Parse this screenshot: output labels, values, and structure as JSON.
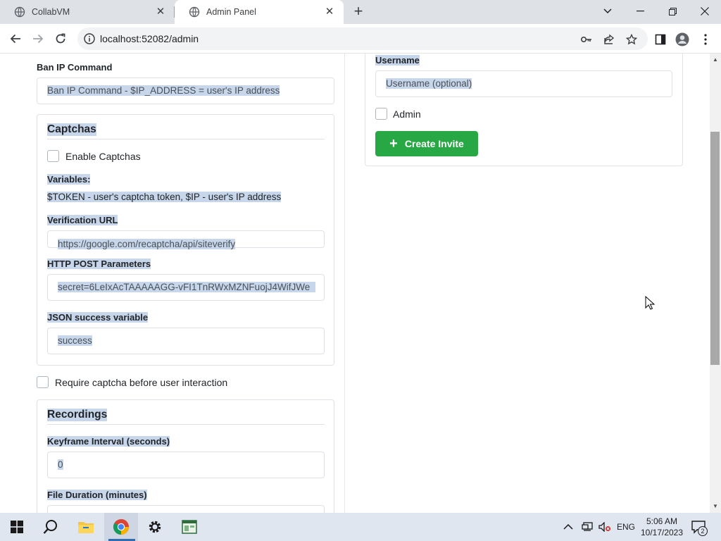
{
  "browser": {
    "tabs": [
      {
        "title": "CollabVM",
        "active": false
      },
      {
        "title": "Admin Panel",
        "active": true
      }
    ],
    "url": "localhost:52082/admin"
  },
  "left_column": {
    "ban_ip": {
      "label": "Ban IP Command",
      "value": "Ban IP Command - $IP_ADDRESS = user's IP address"
    },
    "captchas": {
      "title": "Captchas",
      "enable_label": "Enable Captchas",
      "enable_checked": false,
      "variables_label": "Variables:",
      "variables_text": "$TOKEN - user's captcha token, $IP - user's IP address",
      "verification_url_label": "Verification URL",
      "verification_url_value": "https://google.com/recaptcha/api/siteverify",
      "post_params_label": "HTTP POST Parameters",
      "post_params_value": "secret=6LeIxAcTAAAAAGG-vFI1TnRWxMZNFuojJ4WifJWe",
      "json_success_label": "JSON success variable",
      "json_success_value": "success"
    },
    "require_captcha_label": "Require captcha before user interaction",
    "require_captcha_checked": false,
    "recordings": {
      "title": "Recordings",
      "keyframe_label": "Keyframe Interval (seconds)",
      "keyframe_value": "0",
      "file_duration_label": "File Duration (minutes)"
    }
  },
  "right_column": {
    "username_label": "Username",
    "username_placeholder": "Username (optional)",
    "admin_label": "Admin",
    "admin_checked": false,
    "create_invite_label": "Create Invite"
  },
  "taskbar": {
    "language": "ENG",
    "time": "5:06 AM",
    "date": "10/17/2023",
    "notification_count": "2"
  },
  "colors": {
    "selection_highlight": "#c7d6ea",
    "success_button": "#28a745",
    "tab_strip": "#dee1e6"
  }
}
